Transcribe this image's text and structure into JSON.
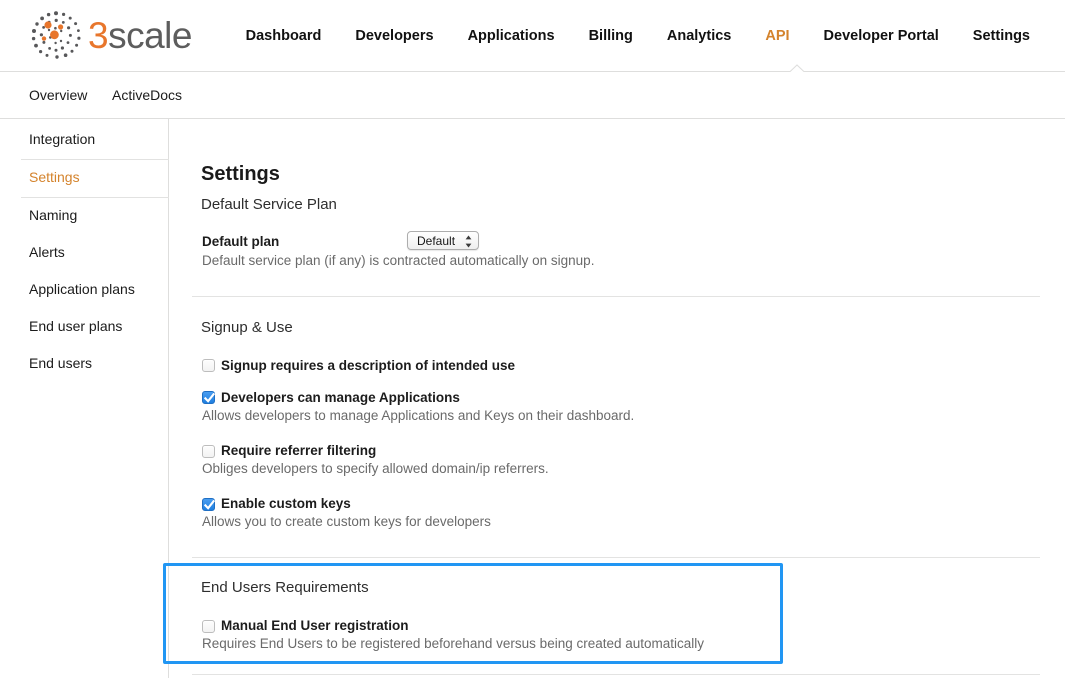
{
  "brand": {
    "logo_text_primary": "3",
    "logo_text_secondary": "scale",
    "logo_icon": "dot-cluster-icon",
    "accent_color": "#e8762c",
    "active_color": "#d4832c",
    "highlight_color": "#2196f3"
  },
  "mainnav": {
    "items": [
      {
        "label": "Dashboard",
        "active": false
      },
      {
        "label": "Developers",
        "active": false
      },
      {
        "label": "Applications",
        "active": false
      },
      {
        "label": "Billing",
        "active": false
      },
      {
        "label": "Analytics",
        "active": false
      },
      {
        "label": "API",
        "active": true
      },
      {
        "label": "Developer Portal",
        "active": false
      },
      {
        "label": "Settings",
        "active": false
      }
    ]
  },
  "subnav": {
    "items": [
      {
        "label": "Overview"
      },
      {
        "label": "ActiveDocs"
      }
    ]
  },
  "sidebar": {
    "items": [
      {
        "label": "Integration",
        "active": false
      },
      {
        "label": "Settings",
        "active": true
      },
      {
        "label": "Naming",
        "active": false
      },
      {
        "label": "Alerts",
        "active": false
      },
      {
        "label": "Application plans",
        "active": false
      },
      {
        "label": "End user plans",
        "active": false
      },
      {
        "label": "End users",
        "active": false
      }
    ]
  },
  "main": {
    "page_title": "Settings",
    "sections": [
      {
        "title": "Default Service Plan",
        "field_label": "Default plan",
        "field_help": "Default service plan (if any) is contracted automatically on signup.",
        "select_value": "Default",
        "select_options": [
          "Default"
        ]
      },
      {
        "title": "Signup & Use",
        "checkboxes": [
          {
            "label": "Signup requires a description of intended use",
            "help": "",
            "checked": false
          },
          {
            "label": "Developers can manage Applications",
            "help": "Allows developers to manage Applications and Keys on their dashboard.",
            "checked": true
          },
          {
            "label": "Require referrer filtering",
            "help": "Obliges developers to specify allowed domain/ip referrers.",
            "checked": false
          },
          {
            "label": "Enable custom keys",
            "help": "Allows you to create custom keys for developers",
            "checked": true
          }
        ]
      },
      {
        "title": "End Users Requirements",
        "highlighted": true,
        "checkboxes": [
          {
            "label": "Manual End User registration",
            "help": "Requires End Users to be registered beforehand versus being created automatically",
            "checked": false
          }
        ]
      }
    ]
  }
}
